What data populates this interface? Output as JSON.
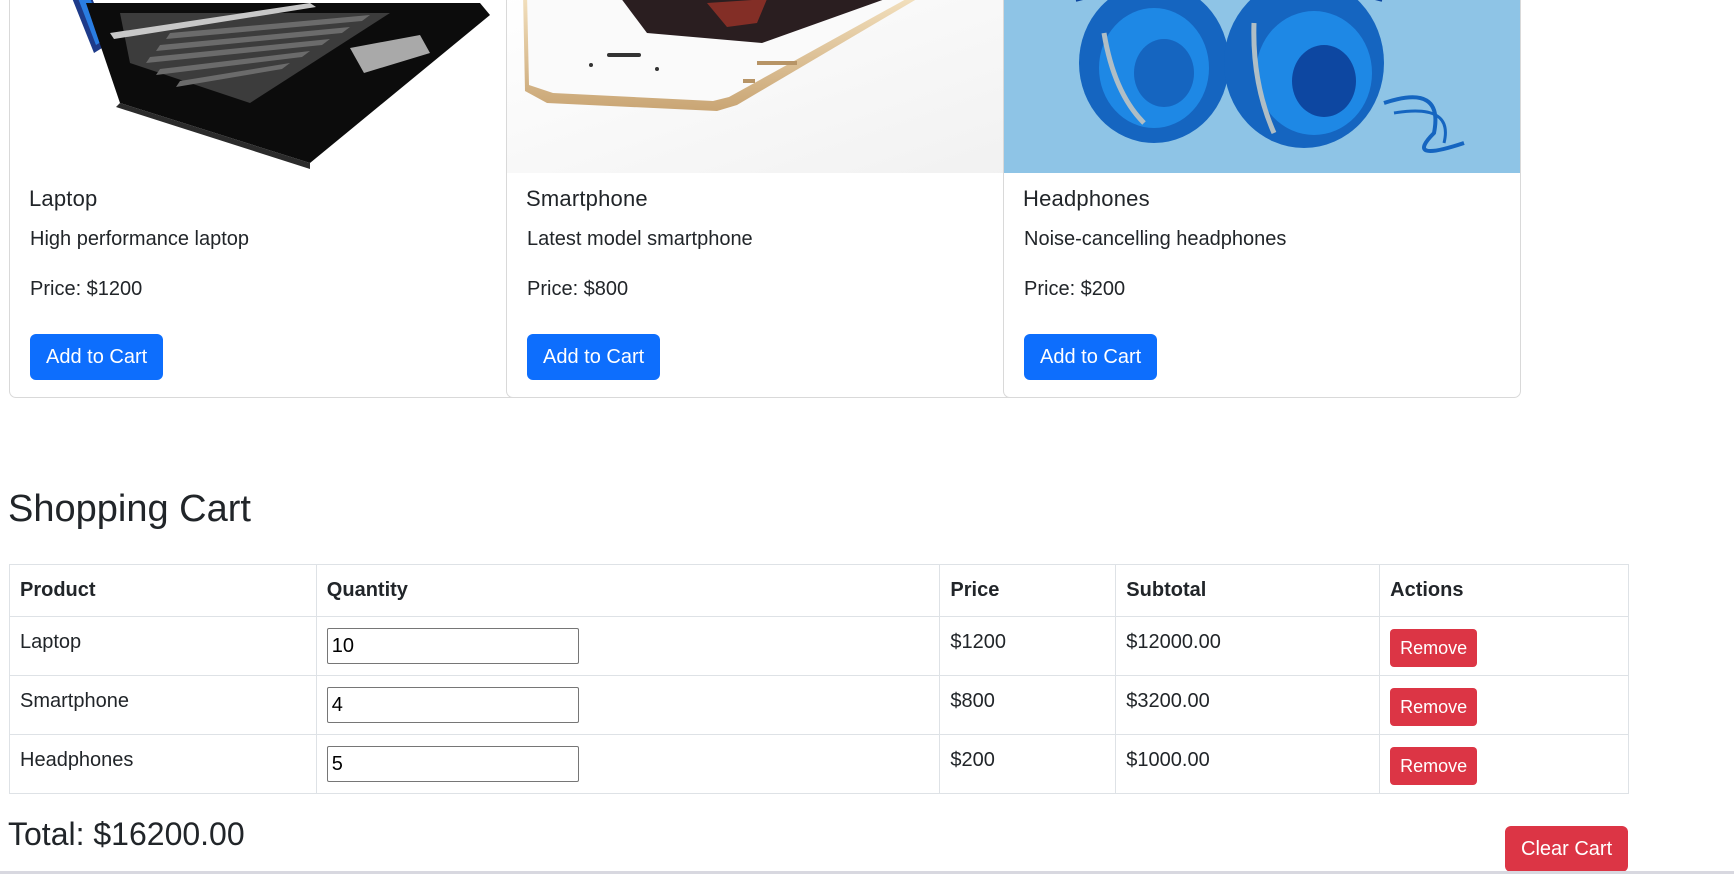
{
  "products": [
    {
      "name": "Laptop",
      "description": "High performance laptop",
      "price": "Price: $1200",
      "button": "Add to Cart",
      "image_icon": "laptop-image"
    },
    {
      "name": "Smartphone",
      "description": "Latest model smartphone",
      "price": "Price: $800",
      "button": "Add to Cart",
      "image_icon": "smartphone-image"
    },
    {
      "name": "Headphones",
      "description": "Noise-cancelling headphones",
      "price": "Price: $200",
      "button": "Add to Cart",
      "image_icon": "headphones-image"
    }
  ],
  "cart": {
    "heading": "Shopping Cart",
    "columns": [
      "Product",
      "Quantity",
      "Price",
      "Subtotal",
      "Actions"
    ],
    "rows": [
      {
        "product": "Laptop",
        "quantity": "10",
        "price": "$1200",
        "subtotal": "$12000.00",
        "action": "Remove"
      },
      {
        "product": "Smartphone",
        "quantity": "4",
        "price": "$800",
        "subtotal": "$3200.00",
        "action": "Remove"
      },
      {
        "product": "Headphones",
        "quantity": "5",
        "price": "$200",
        "subtotal": "$1000.00",
        "action": "Remove"
      }
    ],
    "total_label": "Total:",
    "total_value": "$16200.00",
    "clear_button": "Clear Cart"
  },
  "colors": {
    "primary": "#0d6efd",
    "danger": "#dc3545",
    "text": "#212529",
    "border": "#dee2e6"
  }
}
